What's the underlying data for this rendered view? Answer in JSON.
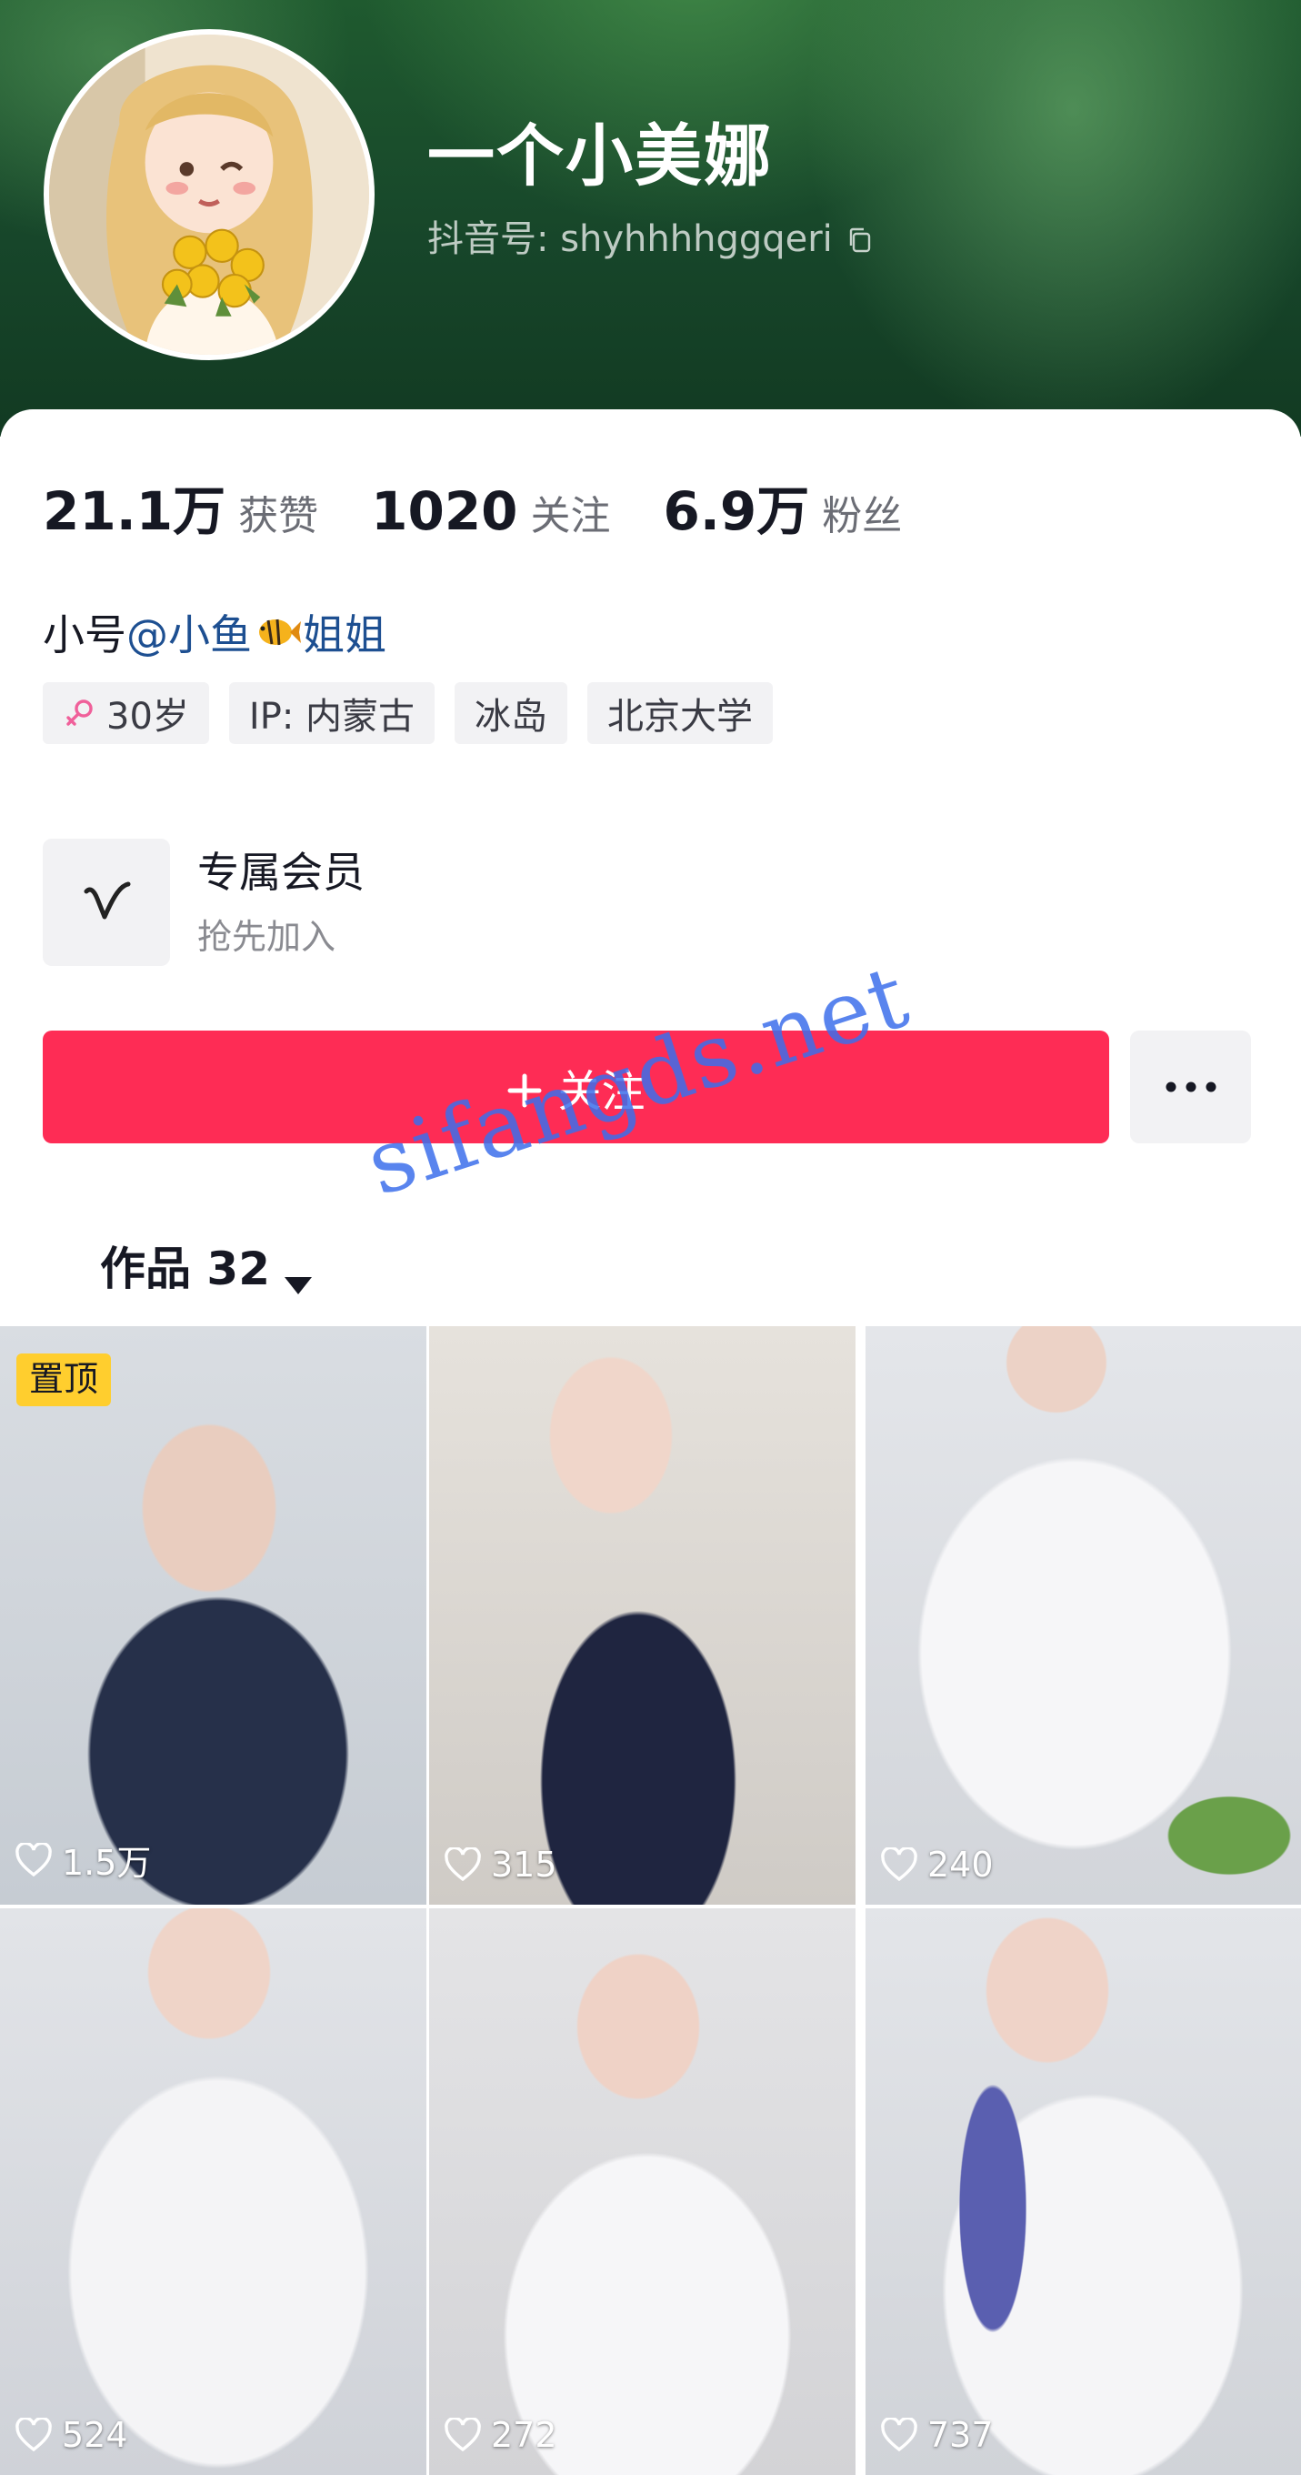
{
  "profile": {
    "nickname": "一个小美娜",
    "douyin_id": "抖音号: shyhhhhggqeri"
  },
  "stats": [
    {
      "value": "21.1万",
      "label": "获赞"
    },
    {
      "value": "1020",
      "label": "关注"
    },
    {
      "value": "6.9万",
      "label": "粉丝"
    }
  ],
  "bio": {
    "prefix": "小号",
    "mention_part1": "@小鱼",
    "mention_emoji": "tropical-fish",
    "mention_part2": "姐姐"
  },
  "tags": [
    {
      "text": "30岁",
      "icon": "female-icon"
    },
    {
      "text": "IP: 内蒙古"
    },
    {
      "text": "冰岛"
    },
    {
      "text": "北京大学"
    }
  ],
  "vip": {
    "title": "专属会员",
    "subtitle": "抢先加入"
  },
  "actions": {
    "follow_label": "关注",
    "more_icon": "more-icon"
  },
  "works_tab": {
    "label": "作品 32"
  },
  "videos": [
    {
      "likes": "1.5万",
      "pinned_label": "置顶"
    },
    {
      "likes": "315"
    },
    {
      "likes": "240"
    },
    {
      "likes": "524"
    },
    {
      "likes": "272"
    },
    {
      "likes": "737"
    }
  ],
  "watermark": "sifangds.net",
  "colors": {
    "accent": "#fe2c55",
    "link": "#1d4f91",
    "pinned": "#ffce2e",
    "banner": "#1f5a2f"
  }
}
